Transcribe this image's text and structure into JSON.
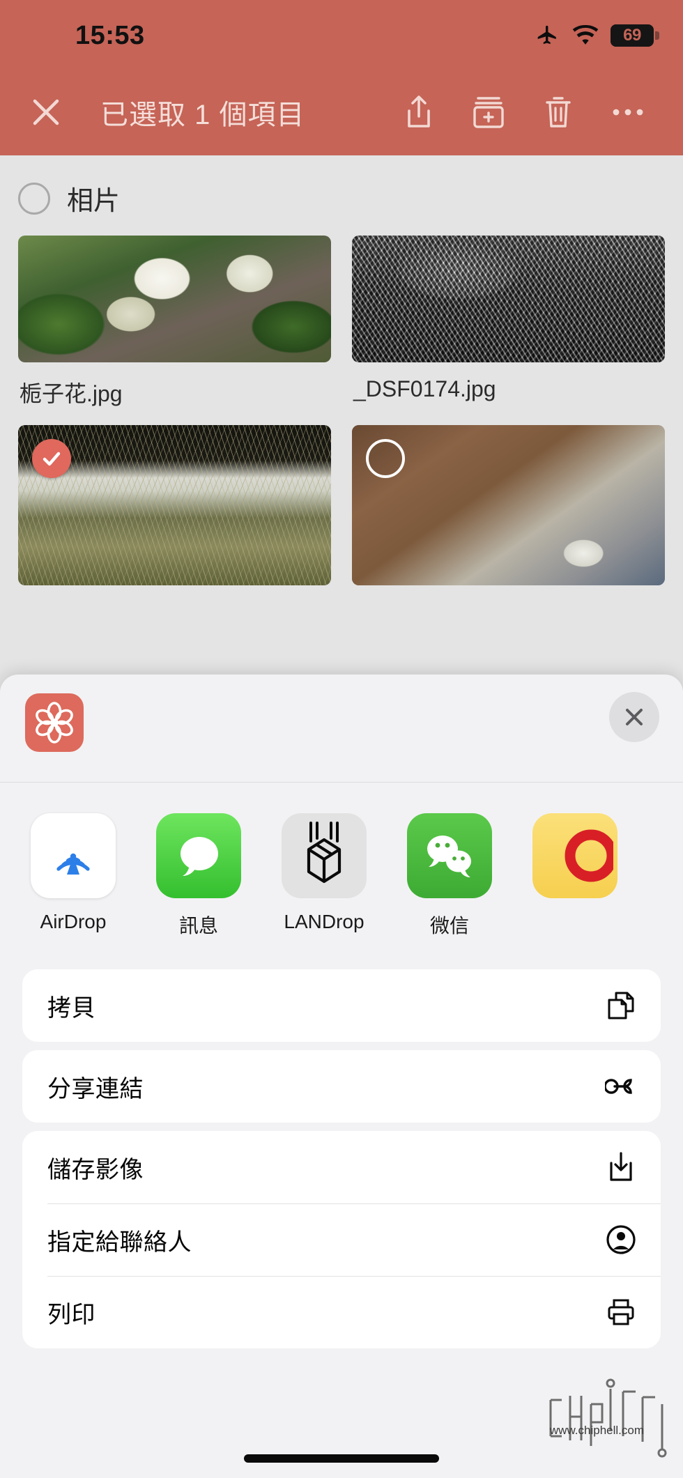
{
  "theme": {
    "accent": "#c56457",
    "accent_light": "#e0685c",
    "sheet_bg": "#f2f2f4",
    "browser_bg": "#e4e4e4",
    "row_bg": "#ffffff"
  },
  "status_bar": {
    "time": "15:53",
    "airplane_icon": "airplane-mode-icon",
    "wifi_icon": "wifi-icon",
    "battery_icon": "battery-icon",
    "battery_level": "69"
  },
  "navbar": {
    "close_icon": "close-icon",
    "title": "已選取 1 個項目",
    "actions": [
      {
        "name": "share-button",
        "icon": "share-up-arrow-icon"
      },
      {
        "name": "add-to-album-button",
        "icon": "add-to-album-icon"
      },
      {
        "name": "delete-button",
        "icon": "trash-icon"
      },
      {
        "name": "more-button",
        "icon": "ellipsis-icon"
      }
    ]
  },
  "browser": {
    "section_label": "相片",
    "section_selected": false,
    "photos": [
      {
        "name": "栀子花.jpg",
        "art": "art-flower",
        "selected": null
      },
      {
        "name": "_DSF0174.jpg",
        "art": "art-bw",
        "selected": null
      },
      {
        "name": "",
        "art": "art-weeds",
        "selected": true
      },
      {
        "name": "",
        "art": "art-cat",
        "selected": false
      }
    ]
  },
  "share_sheet": {
    "app_icon": "flower-rosette-app-icon",
    "close_icon": "close-circle-icon",
    "targets": [
      {
        "label": "AirDrop",
        "icon": "airdrop-icon",
        "tile_class": "t-airdrop"
      },
      {
        "label": "訊息",
        "icon": "messages-icon",
        "tile_class": "t-messages"
      },
      {
        "label": "LANDrop",
        "icon": "landrop-box-icon",
        "tile_class": "t-landrop"
      },
      {
        "label": "微信",
        "icon": "wechat-icon",
        "tile_class": "t-wechat"
      },
      {
        "label": "",
        "icon": "partial-app-icon",
        "tile_class": "t-cut"
      }
    ],
    "action_groups": [
      {
        "rows": [
          {
            "label": "拷貝",
            "icon": "copy-icon"
          }
        ]
      },
      {
        "rows": [
          {
            "label": "分享連結",
            "icon": "link-icon"
          }
        ]
      },
      {
        "rows": [
          {
            "label": "儲存影像",
            "icon": "save-download-icon"
          },
          {
            "label": "指定給聯絡人",
            "icon": "contact-person-icon"
          },
          {
            "label": "列印",
            "icon": "print-icon"
          }
        ]
      }
    ]
  },
  "watermark": {
    "url": "www.chiphell.com",
    "logo": "chiphell-logo"
  }
}
